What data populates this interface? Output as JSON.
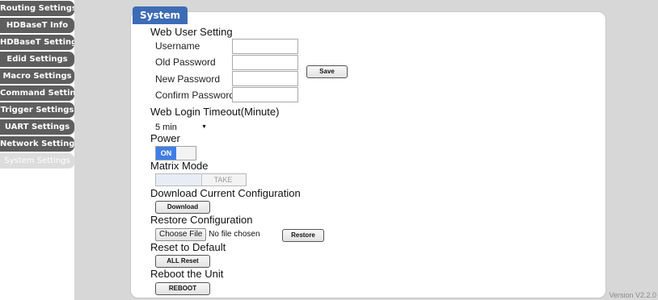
{
  "sidebar": {
    "items": [
      {
        "label": "Routing Settings"
      },
      {
        "label": "HDBaseT Info"
      },
      {
        "label": "HDBaseT Settings"
      },
      {
        "label": "Edid Settings"
      },
      {
        "label": "Macro Settings"
      },
      {
        "label": "Command Settings"
      },
      {
        "label": "Trigger Settings"
      },
      {
        "label": "UART Settings"
      },
      {
        "label": "Network Settings"
      },
      {
        "label": "System Settings"
      }
    ]
  },
  "panel": {
    "title": "System",
    "web_user": {
      "heading": "Web User Setting",
      "username_label": "Username",
      "old_password_label": "Old Password",
      "new_password_label": "New Password",
      "confirm_password_label": "Confirm Password",
      "username_value": "",
      "old_password_value": "",
      "new_password_value": "",
      "confirm_password_value": "",
      "save_label": "Save"
    },
    "timeout": {
      "heading": "Web Login Timeout(Minute)",
      "selected": "5 min"
    },
    "power": {
      "heading": "Power",
      "state": "ON"
    },
    "matrix": {
      "heading": "Matrix Mode",
      "take_label": "TAKE"
    },
    "download": {
      "heading": "Download Current Configuration",
      "button_label": "Download"
    },
    "restore": {
      "heading": "Restore Configuration",
      "choose_file_label": "Choose File",
      "file_status": "No file chosen",
      "button_label": "Restore"
    },
    "reset": {
      "heading": "Reset to Default",
      "button_label": "ALL Reset"
    },
    "reboot": {
      "heading": "Reboot the Unit",
      "button_label": "REBOOT"
    }
  },
  "version": "Version V2.2.0",
  "colors": {
    "tab_blue": "#3d6cb6",
    "toggle_on": "#3f7ee8",
    "nav_gray": "#5e5e5e",
    "backdrop_gray": "#d7d7d7"
  }
}
